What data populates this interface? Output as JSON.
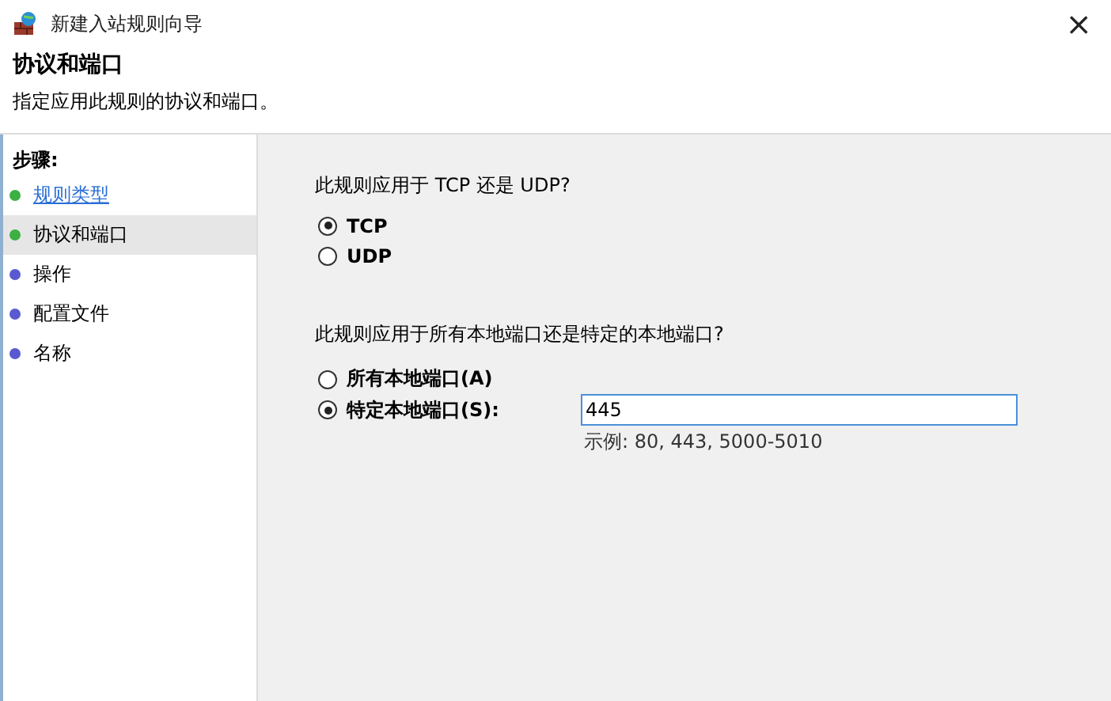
{
  "window": {
    "title": "新建入站规则向导",
    "close": "×"
  },
  "header": {
    "title": "协议和端口",
    "subtitle": "指定应用此规则的协议和端口。"
  },
  "steps": {
    "heading": "步骤:",
    "items": [
      {
        "label": "规则类型",
        "color": "#3cb043",
        "selected": false,
        "link": true
      },
      {
        "label": "协议和端口",
        "color": "#3cb043",
        "selected": true,
        "link": false
      },
      {
        "label": "操作",
        "color": "#5a5ad0",
        "selected": false,
        "link": false
      },
      {
        "label": "配置文件",
        "color": "#5a5ad0",
        "selected": false,
        "link": false
      },
      {
        "label": "名称",
        "color": "#5a5ad0",
        "selected": false,
        "link": false
      }
    ]
  },
  "protocol": {
    "question": "此规则应用于 TCP 还是 UDP?",
    "options": [
      {
        "label": "TCP",
        "selected": true
      },
      {
        "label": "UDP",
        "selected": false
      }
    ]
  },
  "ports": {
    "question": "此规则应用于所有本地端口还是特定的本地端口?",
    "options": [
      {
        "label": "所有本地端口(A)",
        "selected": false
      },
      {
        "label": "特定本地端口(S):",
        "selected": true
      }
    ],
    "value": "445",
    "example": "示例: 80, 443, 5000-5010"
  }
}
